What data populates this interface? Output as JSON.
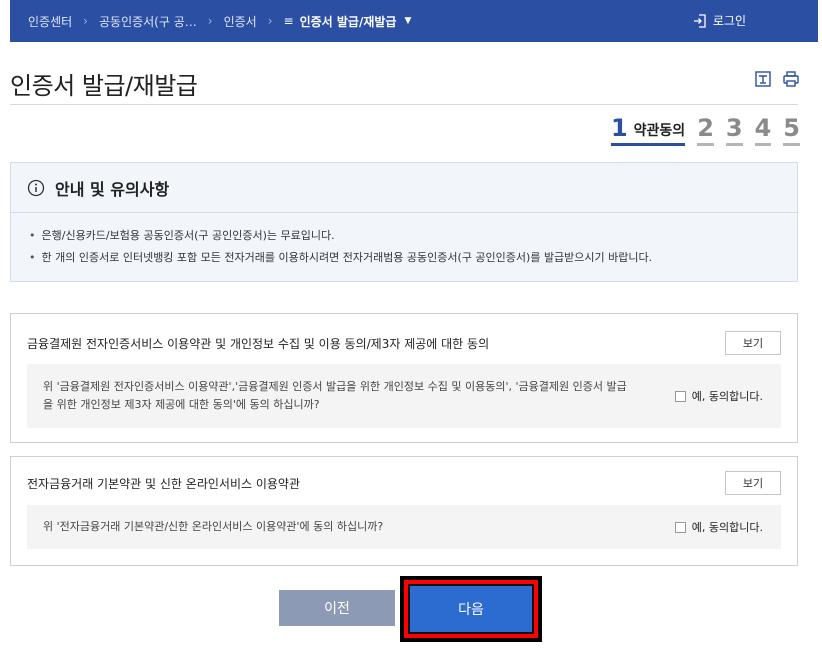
{
  "breadcrumb": {
    "items": [
      "인증센터",
      "공동인증서(구 공…",
      "인증서"
    ],
    "current": "인증서 발급/재발급"
  },
  "header": {
    "login_label": "로그인"
  },
  "page": {
    "title": "인증서 발급/재발급"
  },
  "steps": {
    "active_number": "1",
    "active_label": "약관동의",
    "others": [
      "2",
      "3",
      "4",
      "5"
    ]
  },
  "notice": {
    "title": "안내 및 유의사항",
    "items": [
      "은행/신용카드/보험용 공동인증서(구 공인인증서)는 무료입니다.",
      "한 개의 인증서로 인터넷뱅킹 포함 모든 전자거래를 이용하시려면 전자거래범용 공동인증서(구 공인인증서)를 발급받으시기 바랍니다."
    ]
  },
  "agreements": [
    {
      "title": "금융결제원 전자인증서비스 이용약관 및 개인정보 수집 및 이용 동의/제3자 제공에 대한 동의",
      "view_label": "보기",
      "question_line1": "위 '금융결제원 전자인증서비스 이용약관','금융결제원 인증서 발급을 위한 개인정보 수집 및 이용동의', '금융결제원 인증서 발급",
      "question_line2": "을 위한 개인정보 제3자 제공에 대한 동의'에 동의 하십니까?",
      "checkbox_label": "예, 동의합니다."
    },
    {
      "title": "전자금융거래 기본약관 및 신한 온라인서비스 이용약관",
      "view_label": "보기",
      "question_line1": "위 '전자금융거래 기본약관/신한 온라인서비스 이용약관'에 동의 하십니까?",
      "checkbox_label": "예, 동의합니다."
    }
  ],
  "buttons": {
    "prev": "이전",
    "next": "다음"
  },
  "colors": {
    "topbar": "#2b4fa3",
    "accent": "#2b4fa3",
    "prev_button": "#8c9ab5",
    "next_button": "#2c6bd0",
    "highlight_frame": "#ff0000"
  }
}
